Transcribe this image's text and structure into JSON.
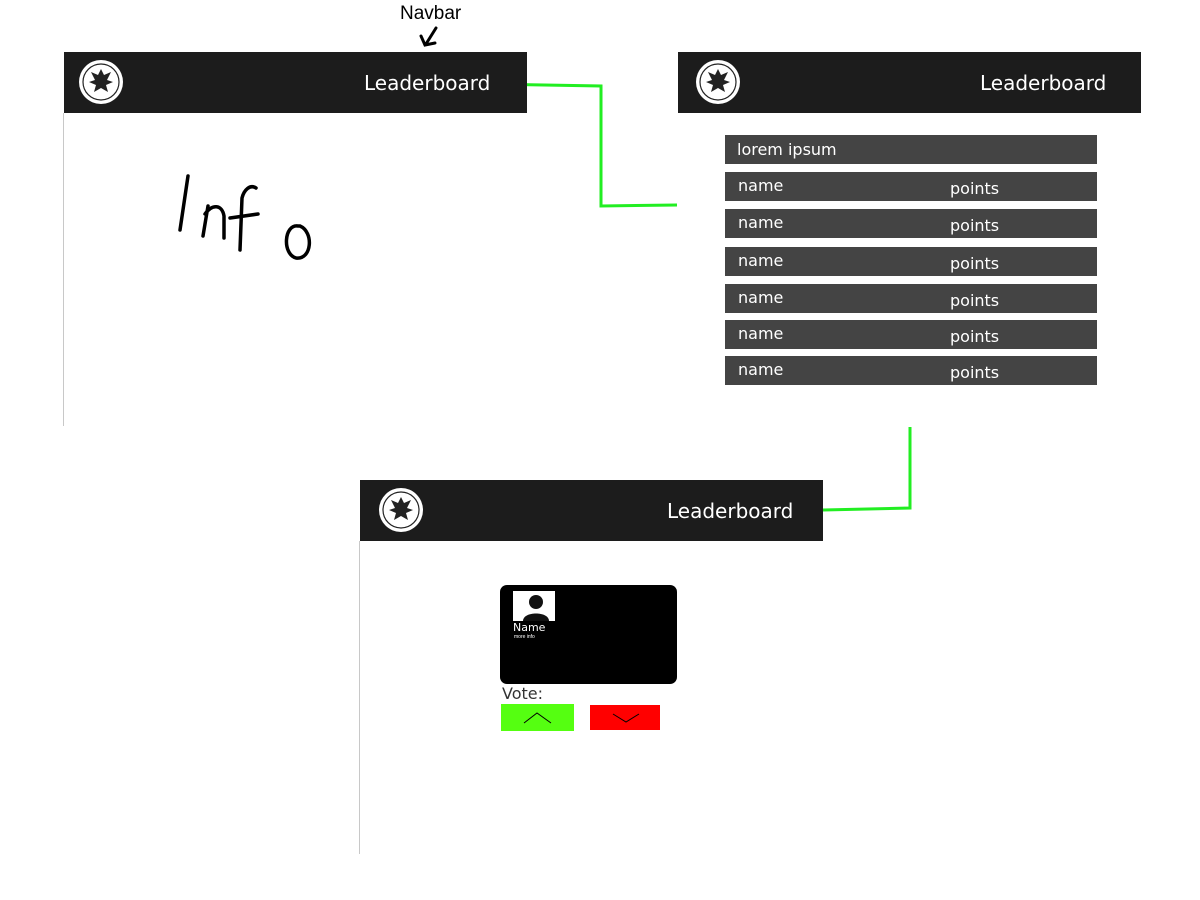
{
  "annotation": {
    "label": "Navbar"
  },
  "frames": {
    "home": {
      "nav_link": "Leaderboard",
      "info_text": "Info"
    },
    "leaderboard": {
      "nav_link": "Leaderboard",
      "header": "lorem ipsum",
      "rows": [
        {
          "name": "name",
          "points": "points"
        },
        {
          "name": "name",
          "points": "points"
        },
        {
          "name": "name",
          "points": "points"
        },
        {
          "name": "name",
          "points": "points"
        },
        {
          "name": "name",
          "points": "points"
        },
        {
          "name": "name",
          "points": "points"
        }
      ]
    },
    "profile": {
      "nav_link": "Leaderboard",
      "card": {
        "name": "Name",
        "more_info": "more info"
      },
      "vote_label": "Vote:"
    }
  },
  "colors": {
    "navbar": "#1c1c1c",
    "row": "#444444",
    "connector": "#22ee22",
    "upvote": "#55ff11",
    "downvote": "#ff0000"
  },
  "icons": {
    "logo": "eagle-seal-icon",
    "upvote": "chevron-up-icon",
    "downvote": "chevron-down-icon",
    "avatar": "user-silhouette-icon"
  }
}
